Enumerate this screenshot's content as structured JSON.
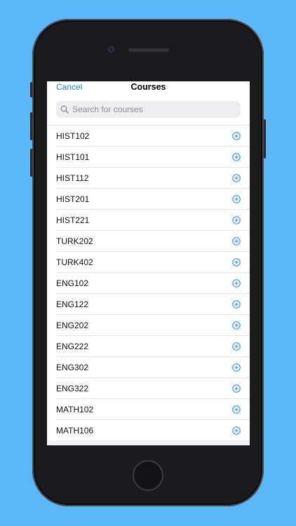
{
  "navbar": {
    "cancel_label": "Cancel",
    "title": "Courses"
  },
  "search": {
    "placeholder": "Search for courses",
    "value": ""
  },
  "courses": [
    {
      "code": "HIST102"
    },
    {
      "code": "HIST101"
    },
    {
      "code": "HIST112"
    },
    {
      "code": "HIST201"
    },
    {
      "code": "HIST221"
    },
    {
      "code": "TURK202"
    },
    {
      "code": "TURK402"
    },
    {
      "code": "ENG102"
    },
    {
      "code": "ENG122"
    },
    {
      "code": "ENG202"
    },
    {
      "code": "ENG222"
    },
    {
      "code": "ENG302"
    },
    {
      "code": "ENG322"
    },
    {
      "code": "MATH102"
    },
    {
      "code": "MATH106"
    }
  ],
  "icons": {
    "add": "plus-circle-icon",
    "search": "search-icon"
  },
  "colors": {
    "background": "#5ab8f9",
    "accent": "#1a85f5"
  }
}
